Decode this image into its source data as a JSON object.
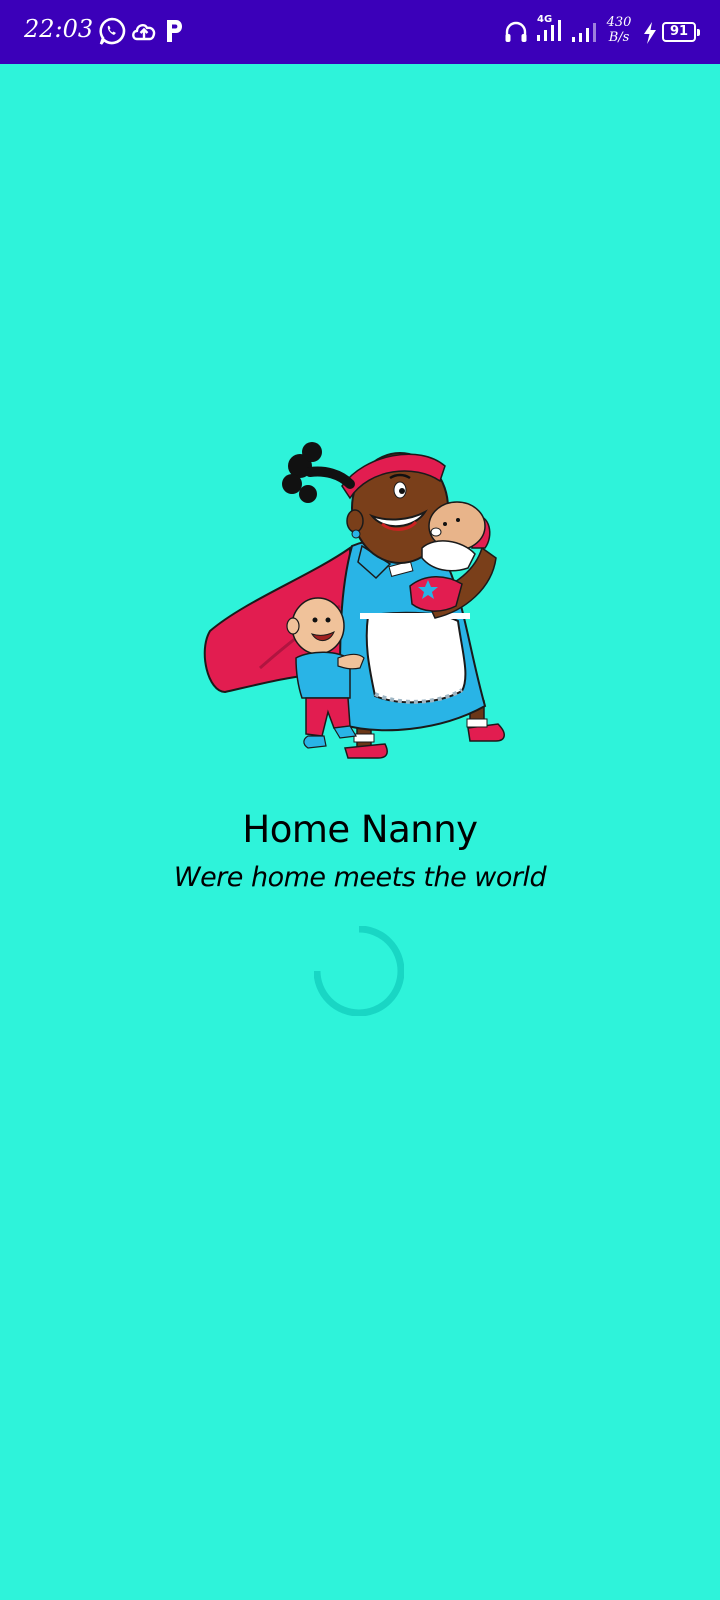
{
  "status_bar": {
    "time": "22:03",
    "net_speed_value": "430",
    "net_speed_unit": "B/s",
    "network_type": "4G",
    "battery": "91",
    "icons": [
      "whatsapp-icon",
      "cloud-upload-icon",
      "parking-app-icon",
      "headset-icon",
      "signal-4g-icon",
      "signal-icon",
      "charging-icon",
      "battery-icon"
    ]
  },
  "splash": {
    "title": "Home Nanny",
    "tagline": "Were home meets the world",
    "illustration": "superhero-nanny-with-babies",
    "loading_indicator": "circular-progress"
  },
  "colors": {
    "status_bar_bg": "#3b00b9",
    "background": "#2ef3da",
    "spinner": "#19d6c4",
    "text": "#000000"
  }
}
